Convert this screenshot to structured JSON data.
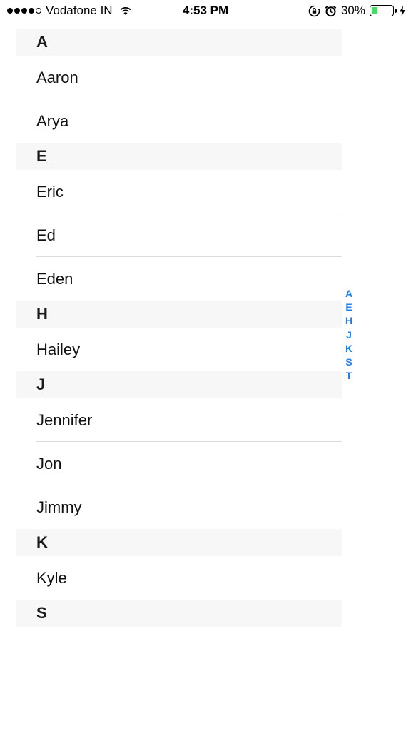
{
  "status_bar": {
    "carrier": "Vodafone IN",
    "time": "4:53 PM",
    "battery_percent": "30%",
    "battery_level": 0.3,
    "signal_bars": 4,
    "icons": [
      "signal-dots",
      "wifi-icon",
      "rotation-lock-icon",
      "alarm-icon",
      "battery-icon",
      "charging-bolt-icon"
    ]
  },
  "sections": [
    {
      "letter": "A",
      "names": [
        "Aaron",
        "Arya"
      ]
    },
    {
      "letter": "E",
      "names": [
        "Eric",
        "Ed",
        "Eden"
      ]
    },
    {
      "letter": "H",
      "names": [
        "Hailey"
      ]
    },
    {
      "letter": "J",
      "names": [
        "Jennifer",
        "Jon",
        "Jimmy"
      ]
    },
    {
      "letter": "K",
      "names": [
        "Kyle"
      ]
    },
    {
      "letter": "S",
      "names": []
    }
  ],
  "index_letters": [
    "A",
    "E",
    "H",
    "J",
    "K",
    "S",
    "T"
  ],
  "colors": {
    "index": "#1a7ff0",
    "battery_fill": "#4cd964",
    "section_bg": "#f7f7f7"
  }
}
